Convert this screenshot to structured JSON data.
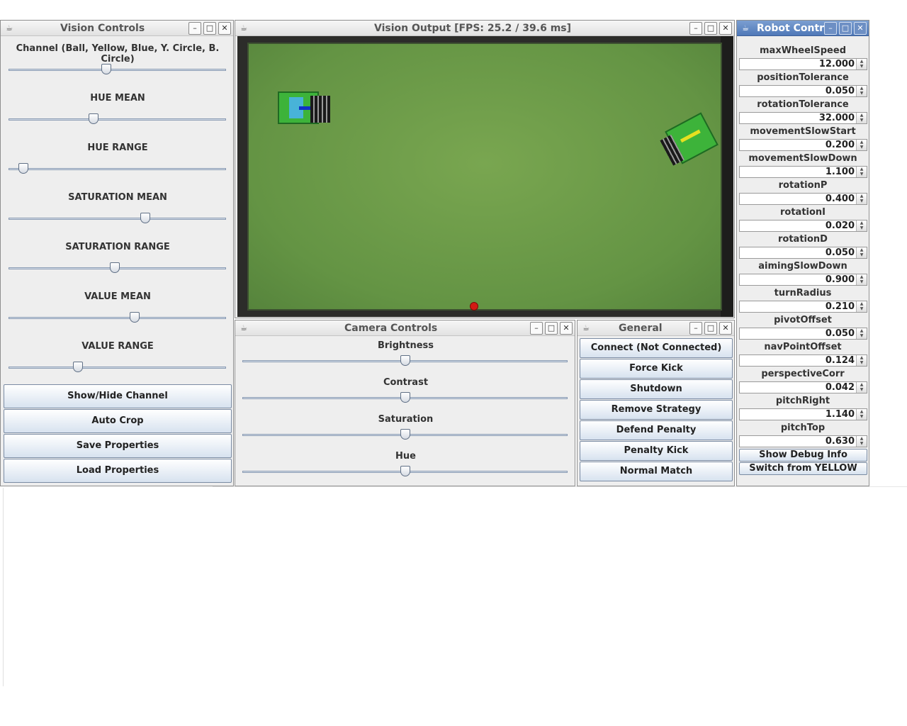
{
  "vision_controls": {
    "title": "Vision Controls",
    "channel_label": "Channel (Ball, Yellow, Blue, Y. Circle, B. Circle)",
    "channel_value": 0.45,
    "sliders": [
      {
        "label": "HUE MEAN",
        "value": 0.39
      },
      {
        "label": "HUE RANGE",
        "value": 0.07
      },
      {
        "label": "SATURATION MEAN",
        "value": 0.63
      },
      {
        "label": "SATURATION RANGE",
        "value": 0.49
      },
      {
        "label": "VALUE MEAN",
        "value": 0.58
      },
      {
        "label": "VALUE RANGE",
        "value": 0.32
      }
    ],
    "buttons": [
      "Show/Hide Channel",
      "Auto Crop",
      "Save Properties",
      "Load Properties"
    ]
  },
  "vision_output": {
    "title": "Vision Output [FPS: 25.2 / 39.6 ms]"
  },
  "camera_controls": {
    "title": "Camera Controls",
    "sliders": [
      {
        "label": "Brightness",
        "value": 0.5
      },
      {
        "label": "Contrast",
        "value": 0.5
      },
      {
        "label": "Saturation",
        "value": 0.5
      },
      {
        "label": "Hue",
        "value": 0.5
      }
    ]
  },
  "general": {
    "title": "General",
    "buttons": [
      "Connect (Not Connected)",
      "Force Kick",
      "Shutdown",
      "Remove Strategy",
      "Defend Penalty",
      "Penalty Kick",
      "Normal Match"
    ]
  },
  "robot_controls": {
    "title": "Robot Contr",
    "params": [
      {
        "label": "maxWheelSpeed",
        "value": "12.000"
      },
      {
        "label": "positionTolerance",
        "value": "0.050"
      },
      {
        "label": "rotationTolerance",
        "value": "32.000"
      },
      {
        "label": "movementSlowStart",
        "value": "0.200"
      },
      {
        "label": "movementSlowDown",
        "value": "1.100"
      },
      {
        "label": "rotationP",
        "value": "0.400"
      },
      {
        "label": "rotationI",
        "value": "0.020"
      },
      {
        "label": "rotationD",
        "value": "0.050"
      },
      {
        "label": "aimingSlowDown",
        "value": "0.900"
      },
      {
        "label": "turnRadius",
        "value": "0.210"
      },
      {
        "label": "pivotOffset",
        "value": "0.050"
      },
      {
        "label": "navPointOffset",
        "value": "0.124"
      },
      {
        "label": "perspectiveCorr",
        "value": "0.042"
      },
      {
        "label": "pitchRight",
        "value": "1.140"
      },
      {
        "label": "pitchTop",
        "value": "0.630"
      }
    ],
    "buttons": [
      "Show Debug Info",
      "Switch from YELLOW"
    ]
  },
  "window_icons": {
    "app": "java-app-icon",
    "minimize": "minimize-icon",
    "maximize": "maximize-icon",
    "close": "close-icon"
  }
}
